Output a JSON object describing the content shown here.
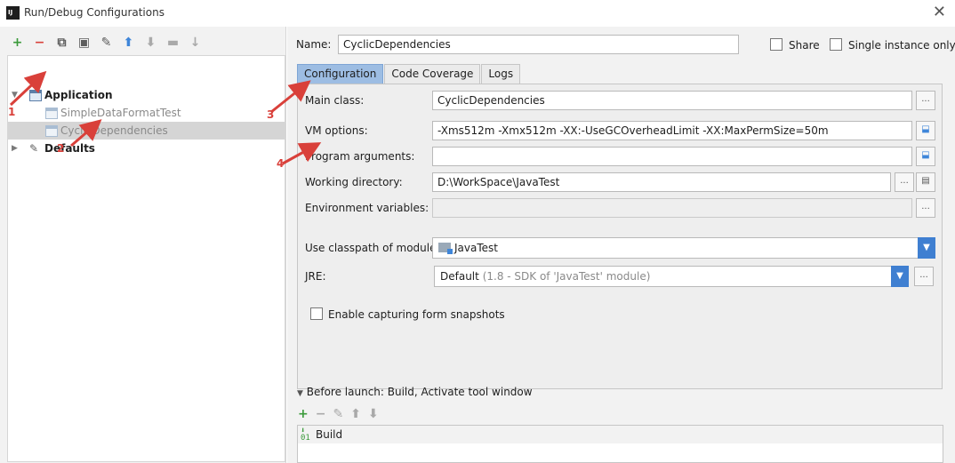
{
  "window": {
    "title": "Run/Debug Configurations",
    "app_icon_text": "IJ"
  },
  "left_toolbar": {
    "icons": [
      "add-icon",
      "remove-icon",
      "copy-icon",
      "save-icon",
      "wrench-icon",
      "move-up-icon",
      "move-down-icon",
      "folder-icon",
      "sort-icon"
    ]
  },
  "tree": {
    "items": [
      {
        "label": "Application",
        "bold": true,
        "expanded": true
      },
      {
        "label": "SimpleDataFormatTest",
        "bold": false
      },
      {
        "label": "CyclicDependencies",
        "bold": false,
        "selected": true
      },
      {
        "label": "Defaults",
        "bold": true,
        "expanded": false
      }
    ]
  },
  "annotations": [
    "1",
    "2",
    "3",
    "4"
  ],
  "header": {
    "name_label": "Name:",
    "name_value": "CyclicDependencies",
    "share_label": "Share",
    "single_instance_label": "Single instance only",
    "share_checked": false,
    "single_instance_checked": false
  },
  "tabs": [
    {
      "label": "Configuration",
      "active": true
    },
    {
      "label": "Code Coverage",
      "active": false
    },
    {
      "label": "Logs",
      "active": false
    }
  ],
  "form": {
    "main_class_label": "Main class:",
    "main_class_value": "CyclicDependencies",
    "vm_options_label": "VM options:",
    "vm_options_value": "-Xms512m  -Xmx512m   -XX:-UseGCOverheadLimit   -XX:MaxPermSize=50m",
    "program_args_label": "Program arguments:",
    "program_args_value": "",
    "working_dir_label": "Working directory:",
    "working_dir_value": "D:\\WorkSpace\\JavaTest",
    "env_vars_label": "Environment variables:",
    "env_vars_value": "",
    "classpath_label": "Use classpath of module:",
    "classpath_value": "JavaTest",
    "jre_label": "JRE:",
    "jre_value": "Default",
    "jre_detail": "(1.8 - SDK of 'JavaTest' module)",
    "snapshots_label": "Enable capturing form snapshots",
    "snapshots_checked": false,
    "ellipsis": "..."
  },
  "before_launch": {
    "title": "Before launch: Build, Activate tool window",
    "items": [
      "Build"
    ]
  },
  "colors": {
    "accent": "#3f7fd1",
    "tab_active": "#9dbde3",
    "annotation": "#d9403a"
  }
}
